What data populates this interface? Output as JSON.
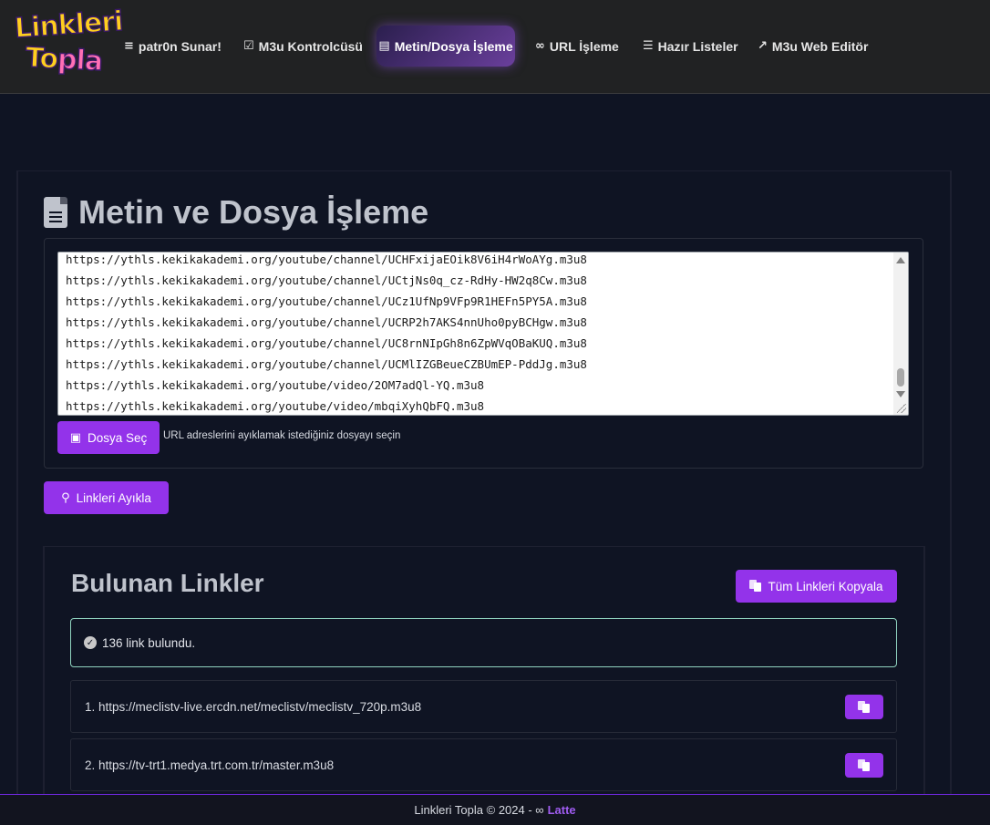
{
  "brand": {
    "logo_line1": "Linkleri",
    "logo_line2a": "To",
    "logo_line2b": "pla"
  },
  "nav": {
    "items": [
      {
        "icon": "list-numbered-icon",
        "glyph": "≡",
        "label": "patr0n Sunar!"
      },
      {
        "icon": "list-check-icon",
        "glyph": "☑",
        "label": "M3u Kontrolcüsü"
      },
      {
        "icon": "file-text-icon",
        "glyph": "▤",
        "label": "Metin/Dosya İşleme"
      },
      {
        "icon": "link-icon",
        "glyph": "∞",
        "label": "URL İşleme"
      },
      {
        "icon": "list-icon",
        "glyph": "☰",
        "label": "Hazır Listeler"
      },
      {
        "icon": "external-link-icon",
        "glyph": "↗",
        "label": "M3u Web Editör"
      }
    ]
  },
  "page": {
    "title": "Metin ve Dosya İşleme"
  },
  "textarea": {
    "lines": [
      "https://ythls.kekikakademi.org/youtube/channel/UCHFxijaEOik8V6iH4rWoAYg.m3u8",
      "https://ythls.kekikakademi.org/youtube/channel/UCtjNs0q_cz-RdHy-HW2q8Cw.m3u8",
      "https://ythls.kekikakademi.org/youtube/channel/UCz1UfNp9VFp9R1HEFn5PY5A.m3u8",
      "https://ythls.kekikakademi.org/youtube/channel/UCRP2h7AKS4nnUho0pyBCHgw.m3u8",
      "https://ythls.kekikakademi.org/youtube/channel/UC8rnNIpGh8n6ZpWVqOBaKUQ.m3u8",
      "https://ythls.kekikakademi.org/youtube/channel/UCMlIZGBeueCZBUmEP-PddJg.m3u8",
      "https://ythls.kekikakademi.org/youtube/video/2OM7adQl-YQ.m3u8",
      "https://ythls.kekikakademi.org/youtube/video/mbqiXyhQbFQ.m3u8"
    ]
  },
  "file_input": {
    "button_label": "Dosya Seç",
    "hint": "URL adreslerini ayıklamak istediğiniz dosyayı seçin"
  },
  "extract_button": {
    "label": "Linkleri Ayıkla"
  },
  "results": {
    "title": "Bulunan Linkler",
    "copy_all_label": "Tüm Linkleri Kopyala",
    "status": "136 link bulundu.",
    "links": [
      "1. https://meclistv-live.ercdn.net/meclistv/meclistv_720p.m3u8",
      "2. https://tv-trt1.medya.trt.com.tr/master.m3u8"
    ]
  },
  "footer": {
    "text": "Linkleri Topla © 2024 - ∞",
    "brand": "Latte"
  },
  "colors": {
    "accent": "#9333ea",
    "background": "#0f1423",
    "navbar": "#212223",
    "alert_border": "#8fd3bf"
  }
}
